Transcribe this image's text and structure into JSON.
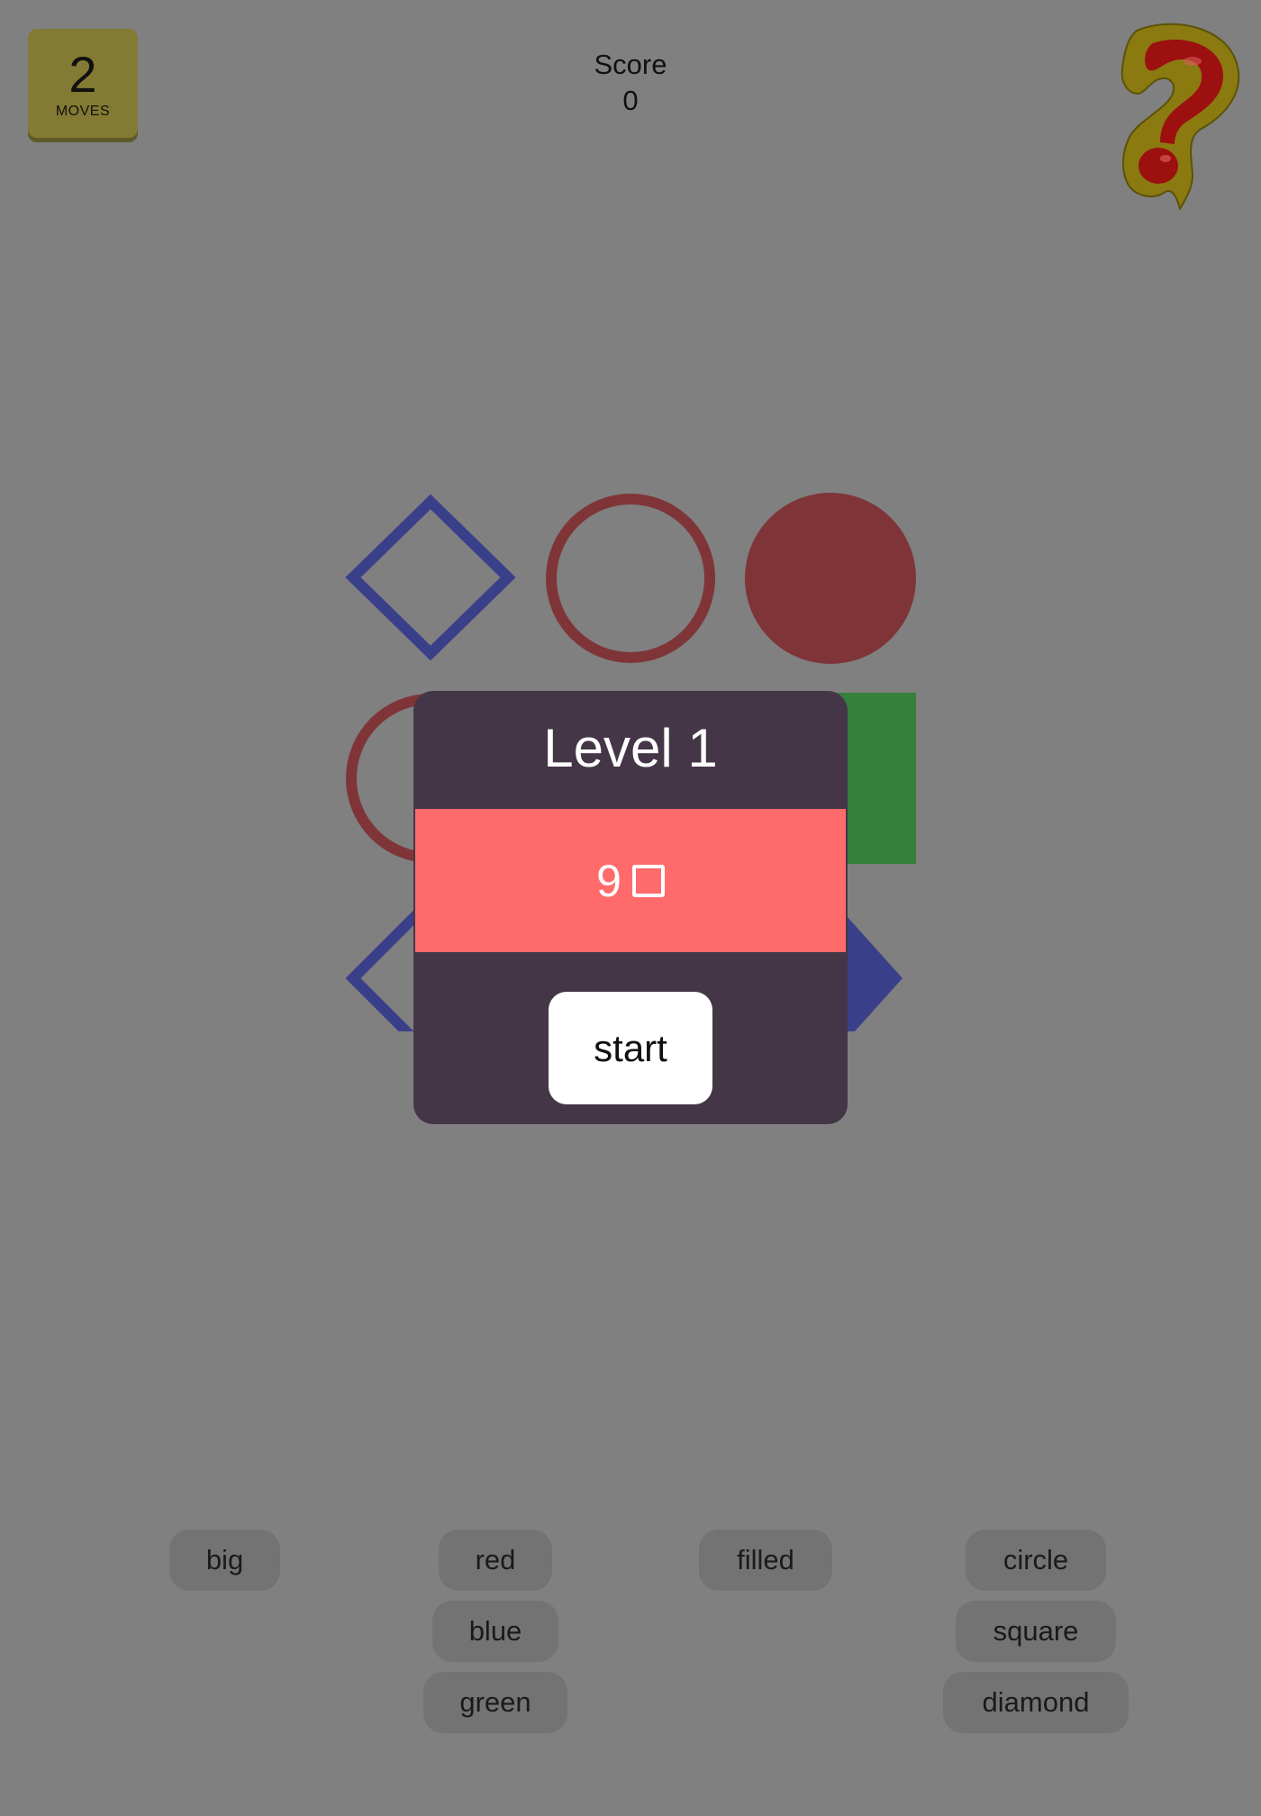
{
  "moves": {
    "count": "2",
    "label": "MOVES"
  },
  "score": {
    "label": "Score",
    "value": "0"
  },
  "help": {
    "icon": "question-mark-icon"
  },
  "board": {
    "shapes": [
      {
        "shape": "diamond",
        "color": "#3a3f8a",
        "filled": false
      },
      {
        "shape": "circle",
        "color": "#7f3538",
        "filled": false
      },
      {
        "shape": "circle",
        "color": "#7f3538",
        "filled": true
      },
      {
        "shape": "circle",
        "color": "#7f3538",
        "filled": false
      },
      {
        "shape": "square",
        "color": "#35803a",
        "filled": true
      },
      {
        "shape": "diamond",
        "color": "#3a3f8a",
        "filled": false
      },
      {
        "shape": "diamond",
        "color": "#3a3f8a",
        "filled": true
      }
    ]
  },
  "modal": {
    "title": "Level 1",
    "goal_count": "9",
    "goal_icon": "square-outline-icon",
    "start_label": "start"
  },
  "filters": {
    "size": [
      "big"
    ],
    "color": [
      "red",
      "blue",
      "green"
    ],
    "fill": [
      "filled"
    ],
    "shape": [
      "circle",
      "square",
      "diamond"
    ]
  },
  "colors": {
    "background": "#808080",
    "modal": "#443647",
    "goal_banner": "#ff6b6b",
    "moves_badge": "#837a33"
  }
}
